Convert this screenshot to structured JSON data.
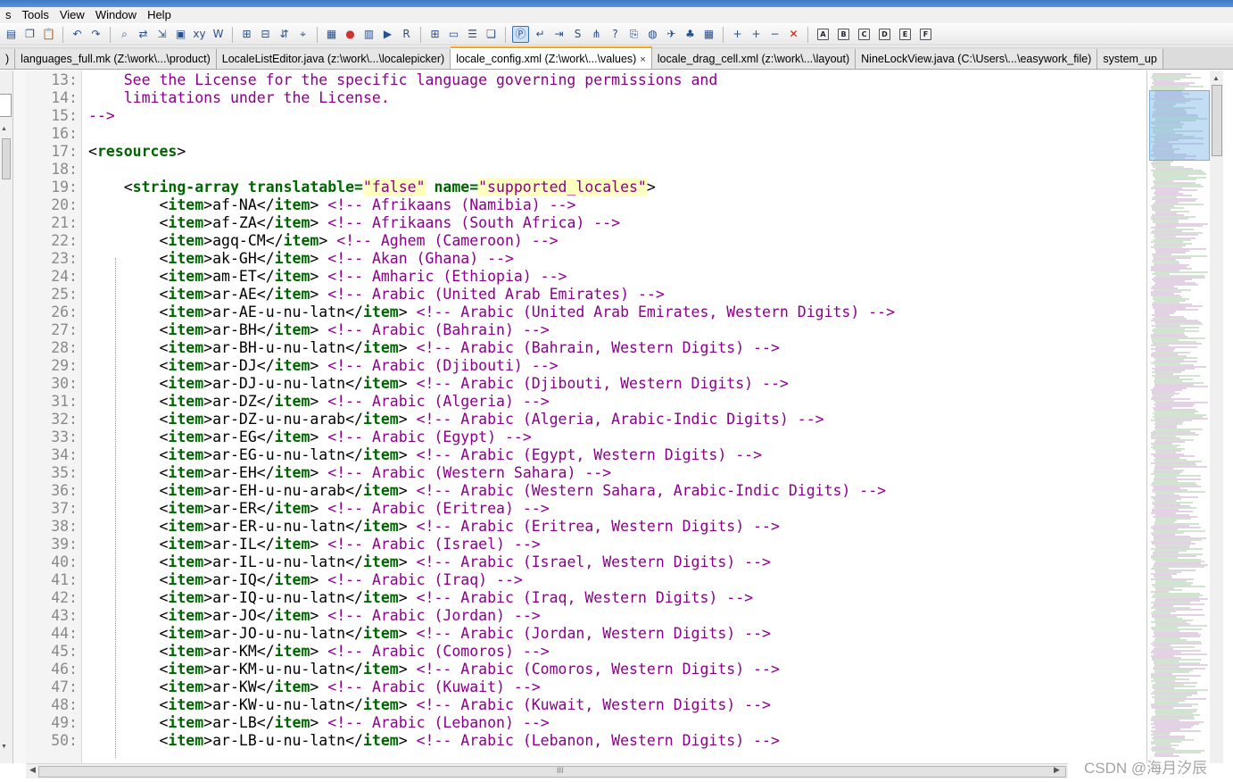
{
  "menubar": [
    "s",
    "Tools",
    "View",
    "Window",
    "Help"
  ],
  "toolbar_icons": [
    "new-file-icon",
    "copy-icon",
    "paste-icon",
    "|",
    "undo-icon",
    "redo-icon",
    "|",
    "find-icon",
    "replace-icon",
    "goto-icon",
    "bookmark-icon",
    "wordwrap-xy-icon",
    "word-icon",
    "|",
    "zoom-in-icon",
    "zoom-out-icon",
    "sync-icon",
    "focus-icon",
    "|",
    "macro-icon",
    "record-icon",
    "book-icon",
    "play-icon",
    "regex-icon",
    "|",
    "panel-a-icon",
    "panel-b-icon",
    "panel-c-icon",
    "panel-d-icon",
    "|",
    "plugin-p-icon",
    "wrap-icon",
    "indent-icon",
    "s-icon",
    "network-icon",
    "help-icon",
    "clip-icon",
    "ball-icon",
    "bird-icon",
    "tree-icon",
    "grid-icon",
    "|",
    "add-icon",
    "add-row-icon",
    "remove-row-icon",
    "delete-icon",
    "|",
    "box-a-icon",
    "box-b-icon",
    "box-c-icon",
    "box-d-icon",
    "box-e-icon",
    "box-f-icon"
  ],
  "toolbar_boxed_labels": {
    "box-a-icon": "A",
    "box-b-icon": "B",
    "box-c-icon": "C",
    "box-d-icon": "D",
    "box-e-icon": "E",
    "box-f-icon": "F"
  },
  "tabs": [
    {
      "label": ")",
      "active": false
    },
    {
      "label": "languages_full.mk (Z:\\work\\...\\product)",
      "active": false
    },
    {
      "label": "LocaleListEditor.java (z:\\work\\...\\localepicker)",
      "active": false
    },
    {
      "label": "locale_config.xml (Z:\\work\\...\\values)",
      "active": true,
      "close": "×"
    },
    {
      "label": "locale_drag_cell.xml (z:\\work\\...\\layout)",
      "active": false
    },
    {
      "label": "NineLockView.java (C:\\Users\\...\\easywork_file)",
      "active": false
    },
    {
      "label": "system_up",
      "active": false
    }
  ],
  "editor": {
    "lines": [
      {
        "n": "13:",
        "parts": [
          {
            "t": "cm",
            "v": "    See the License for the specific language governing permissions and"
          }
        ]
      },
      {
        "n": "14:",
        "parts": [
          {
            "t": "cm",
            "v": "    limitations under the License."
          }
        ]
      },
      {
        "n": "15:",
        "parts": [
          {
            "t": "cm",
            "v": "-->"
          }
        ]
      },
      {
        "n": "16:",
        "parts": []
      },
      {
        "n": "17:",
        "parts": [
          {
            "t": "tx",
            "v": "<"
          },
          {
            "t": "tg",
            "v": "resources"
          },
          {
            "t": "tx",
            "v": ">"
          }
        ]
      },
      {
        "n": "18:",
        "parts": []
      },
      {
        "n": "19:",
        "parts": [
          {
            "t": "tx",
            "v": "    <"
          },
          {
            "t": "tg",
            "v": "string-array"
          },
          {
            "t": "tx",
            "v": " "
          },
          {
            "t": "an",
            "v": "translatable="
          },
          {
            "t": "av",
            "v": "\"false\""
          },
          {
            "t": "tx",
            "v": " "
          },
          {
            "t": "an",
            "v": "name="
          },
          {
            "t": "av",
            "v": "\"supported_locales\""
          },
          {
            "t": "tx",
            "v": ">"
          }
        ]
      },
      {
        "n": "20:",
        "item": "af-NA",
        "comment": "Afrikaans (Namibia)"
      },
      {
        "n": "21:",
        "item": "af-ZA",
        "comment": "Afrikaans (South Africa)"
      },
      {
        "n": "22:",
        "item": "agq-CM",
        "comment": "Aghem (Cameroon)"
      },
      {
        "n": "23:",
        "item": "ak-GH",
        "comment": "Akan (Ghana)"
      },
      {
        "n": "24:",
        "item": "am-ET",
        "comment": "Amharic (Ethiopia)"
      },
      {
        "n": "25:",
        "item": "ar-AE",
        "comment": "Arabic (United Arab Emirates)"
      },
      {
        "n": "26:",
        "item": "ar-AE-u-nu-latn",
        "comment": "Arabic (United Arab Emirates, Western Digits)"
      },
      {
        "n": "27:",
        "item": "ar-BH",
        "comment": "Arabic (Bahrain)"
      },
      {
        "n": "28:",
        "item": "ar-BH-u-nu-latn",
        "comment": "Arabic (Bahrain, Western Digits)"
      },
      {
        "n": "29:",
        "item": "ar-DJ",
        "comment": "Arabic (Djibouti)"
      },
      {
        "n": "30:",
        "item": "ar-DJ-u-nu-latn",
        "comment": "Arabic (Djibouti, Western Digits)"
      },
      {
        "n": "31:",
        "item": "ar-DZ",
        "comment": "Arabic (Algeria)"
      },
      {
        "n": "32:",
        "item": "ar-DZ-u-nu-arab",
        "comment": "Arabic (Algeria, Arabic-Indic Digits)"
      },
      {
        "n": "33:",
        "item": "ar-EG",
        "comment": "Arabic (Egypt)"
      },
      {
        "n": "34:",
        "item": "ar-EG-u-nu-latn",
        "comment": "Arabic (Egypt, Western Digits)"
      },
      {
        "n": "35:",
        "item": "ar-EH",
        "comment": "Arabic (Western Sahara)"
      },
      {
        "n": "36:",
        "item": "ar-EH-u-nu-arab",
        "comment": "Arabic (Western Sahara, Arabic-Indic Digits)"
      },
      {
        "n": "37:",
        "item": "ar-ER",
        "comment": "Arabic (Eritrea)"
      },
      {
        "n": "38:",
        "item": "ar-ER-u-nu-latn",
        "comment": "Arabic (Eritrea, Western Digits)"
      },
      {
        "n": "39:",
        "item": "ar-IL",
        "comment": "Arabic (Israel)"
      },
      {
        "n": "40:",
        "item": "ar-IL-u-nu-latn",
        "comment": "Arabic (Israel, Western Digits)"
      },
      {
        "n": "41:",
        "item": "ar-IQ",
        "comment": "Arabic (Iraq)"
      },
      {
        "n": "42:",
        "item": "ar-IQ-u-nu-latn",
        "comment": "Arabic (Iraq, Western Digits)"
      },
      {
        "n": "43:",
        "item": "ar-JO",
        "comment": "Arabic (Jordan)"
      },
      {
        "n": "44:",
        "item": "ar-JO-u-nu-latn",
        "comment": "Arabic (Jordan, Western Digits)"
      },
      {
        "n": "45:",
        "item": "ar-KM",
        "comment": "Arabic (Comoros)"
      },
      {
        "n": "46:",
        "item": "ar-KM-u-nu-latn",
        "comment": "Arabic (Comoros, Western Digits)"
      },
      {
        "n": "47:",
        "item": "ar-KW",
        "comment": "Arabic (Kuwait)"
      },
      {
        "n": "48:",
        "item": "ar-KW-u-nu-latn",
        "comment": "Arabic (Kuwait, Western Digits)"
      },
      {
        "n": "49:",
        "item": "ar-LB",
        "comment": "Arabic (Lebanon)"
      },
      {
        "n": "50:",
        "item": "ar-LB-u-nu-latn",
        "comment": "Arabic (Lebanon, Western Digits)"
      }
    ]
  },
  "hscroll_grip": "III",
  "watermark": "CSDN @海月汐辰"
}
